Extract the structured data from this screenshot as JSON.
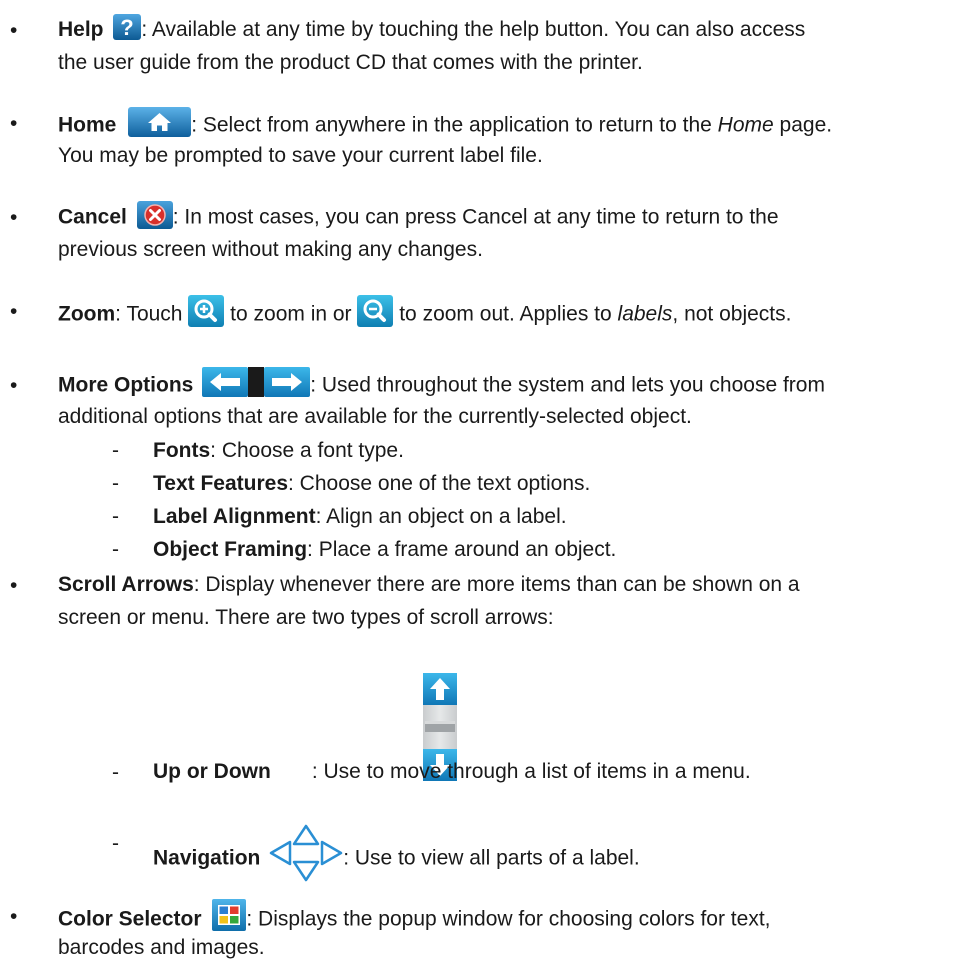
{
  "bullet_char": "•",
  "dash_char": "-",
  "help": {
    "term": "Help",
    "text1": ": Available at any time by touching the help button. You can also access",
    "text2": "the user guide from the product CD that comes with the printer."
  },
  "home": {
    "term": "Home",
    "text1a": ": Select from anywhere in the application to return to the ",
    "text1_italic": "Home",
    "text1b": " page.",
    "text2": "You may be prompted to save your current label file."
  },
  "cancel": {
    "term": "Cancel",
    "text1": ": In most cases, you can press Cancel at any time to return to the",
    "text2": "previous screen without making any changes."
  },
  "zoom": {
    "term": "Zoom",
    "text_a": ": Touch ",
    "text_b": " to zoom in or ",
    "text_c": " to zoom out. Applies to ",
    "text_italic": "labels",
    "text_d": ", not objects."
  },
  "more_options": {
    "term": "More Options",
    "text1": ": Used throughout the system and lets you choose from",
    "text2": "additional options that are available for the currently-selected object.",
    "subitems": [
      {
        "term": "Fonts",
        "text": ": Choose a font type."
      },
      {
        "term": "Text Features",
        "text": ": Choose one of the text options."
      },
      {
        "term": "Label Alignment",
        "text": ": Align an object on a label."
      },
      {
        "term": "Object Framing",
        "text": ": Place a frame around an object."
      }
    ]
  },
  "scroll": {
    "term": "Scroll Arrows",
    "text1": ": Display whenever there are more items than can be shown on a",
    "text2": "screen or menu. There are two types of scroll arrows:",
    "up_down_term": "Up or Down",
    "up_down_text": ": Use to move through a list of items in a menu.",
    "nav_term": "Navigation",
    "nav_text": ": Use to view all parts of a label."
  },
  "color": {
    "term": "Color Selector",
    "text1": ": Displays the popup window for choosing colors for text,",
    "text2": "barcodes and images."
  },
  "colors": {
    "icon_blue": "#1f7fc4",
    "icon_blue_dark": "#0d5a93",
    "cancel_red": "#d9302b",
    "zoom_teal": "#1aa0c8"
  }
}
